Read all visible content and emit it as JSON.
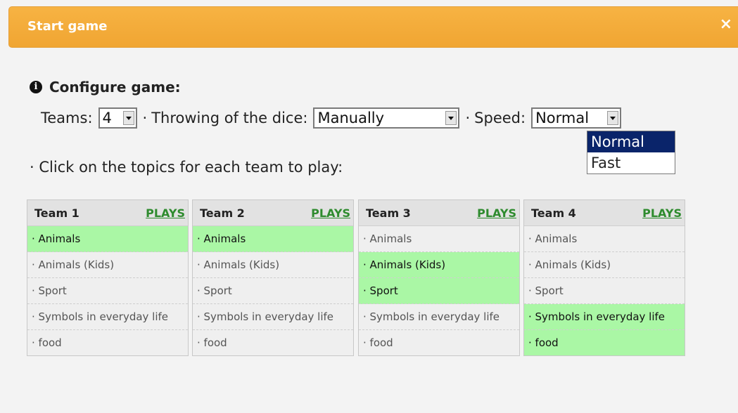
{
  "dialog": {
    "title": "Start game",
    "close_label": "×"
  },
  "config": {
    "heading": "Configure game:",
    "info_icon_glyph": "i",
    "teams_label": "Teams:",
    "teams_value": "4",
    "separator": "·",
    "dice_label": "Throwing of the dice:",
    "dice_value": "Manually",
    "speed_label": "Speed:",
    "speed_value": "Normal",
    "speed_options": [
      "Normal",
      "Fast"
    ],
    "speed_selected_option": "Normal",
    "topics_hint": "· Click on the topics for each team to play:"
  },
  "teams": [
    {
      "name": "Team 1",
      "plays_label": "PLAYS",
      "topics": [
        {
          "label": "· Animals",
          "selected": true
        },
        {
          "label": "· Animals (Kids)",
          "selected": false
        },
        {
          "label": "· Sport",
          "selected": false
        },
        {
          "label": "· Symbols in everyday life",
          "selected": false
        },
        {
          "label": "· food",
          "selected": false
        }
      ]
    },
    {
      "name": "Team 2",
      "plays_label": "PLAYS",
      "topics": [
        {
          "label": "· Animals",
          "selected": true
        },
        {
          "label": "· Animals (Kids)",
          "selected": false
        },
        {
          "label": "· Sport",
          "selected": false
        },
        {
          "label": "· Symbols in everyday life",
          "selected": false
        },
        {
          "label": "· food",
          "selected": false
        }
      ]
    },
    {
      "name": "Team 3",
      "plays_label": "PLAYS",
      "topics": [
        {
          "label": "· Animals",
          "selected": false
        },
        {
          "label": "· Animals (Kids)",
          "selected": true
        },
        {
          "label": "· Sport",
          "selected": true
        },
        {
          "label": "· Symbols in everyday life",
          "selected": false
        },
        {
          "label": "· food",
          "selected": false
        }
      ]
    },
    {
      "name": "Team 4",
      "plays_label": "PLAYS",
      "topics": [
        {
          "label": "· Animals",
          "selected": false
        },
        {
          "label": "· Animals (Kids)",
          "selected": false
        },
        {
          "label": "· Sport",
          "selected": false
        },
        {
          "label": "· Symbols in everyday life",
          "selected": true
        },
        {
          "label": "· food",
          "selected": true
        }
      ]
    }
  ],
  "colors": {
    "titlebar": "#f0a532",
    "selected_topic": "#aaf7a5",
    "plays_link": "#2e8b2e",
    "dropdown_highlight": "#0a246a"
  }
}
